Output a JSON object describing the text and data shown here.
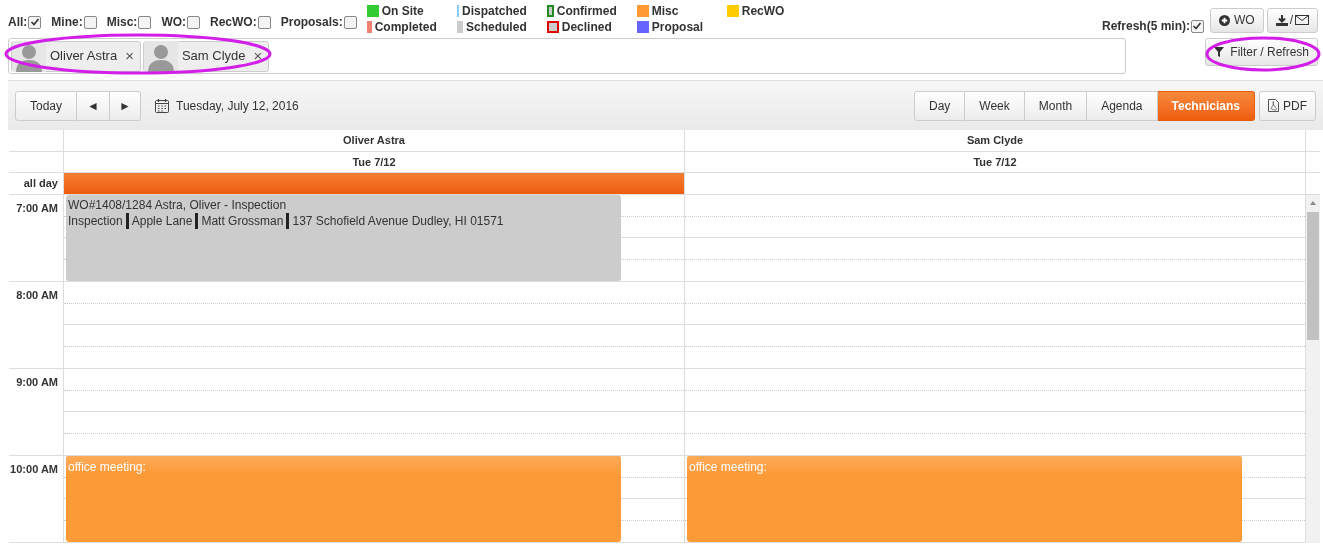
{
  "filters": [
    {
      "label": "All:",
      "checked": true
    },
    {
      "label": "Mine:",
      "checked": false
    },
    {
      "label": "Misc:",
      "checked": false
    },
    {
      "label": "WO:",
      "checked": false
    },
    {
      "label": "RecWO:",
      "checked": false
    },
    {
      "label": "Proposals:",
      "checked": false
    }
  ],
  "legend": [
    {
      "label": "On Site",
      "kind": "fill",
      "color": "#33cc33"
    },
    {
      "label": "Completed",
      "kind": "fill",
      "color": "#f08070"
    },
    {
      "label": "Dispatched",
      "kind": "fill",
      "color": "#87cefa"
    },
    {
      "label": "Scheduled",
      "kind": "fill",
      "color": "#cccccc"
    },
    {
      "label": "Confirmed",
      "kind": "outline",
      "color": "#228b22"
    },
    {
      "label": "Declined",
      "kind": "outline",
      "color": "#e00000"
    },
    {
      "label": "Misc",
      "kind": "fill",
      "color": "#ff9933"
    },
    {
      "label": "Proposal",
      "kind": "fill",
      "color": "#6666ff"
    },
    {
      "label": "RecWO",
      "kind": "fill",
      "color": "#ffcc00"
    }
  ],
  "refresh": {
    "label": "Refresh(5 min):",
    "checked": true
  },
  "wo_button": "WO",
  "export_button": "/",
  "technician_chips": [
    {
      "name": "Oliver Astra",
      "remove": "×"
    },
    {
      "name": "Sam Clyde",
      "remove": "×"
    }
  ],
  "filter_button": "Filter / Refresh",
  "toolbar": {
    "today": "Today",
    "prev": "◄",
    "next": "►",
    "date": "Tuesday, July 12, 2016",
    "views": [
      {
        "label": "Day",
        "selected": false
      },
      {
        "label": "Week",
        "selected": false
      },
      {
        "label": "Month",
        "selected": false
      },
      {
        "label": "Agenda",
        "selected": false
      },
      {
        "label": "Technicians",
        "selected": true
      }
    ],
    "pdf": "PDF"
  },
  "calendar": {
    "all_day_label": "all day",
    "columns": [
      {
        "name": "Oliver Astra",
        "date": "Tue 7/12",
        "all_day_event": true
      },
      {
        "name": "Sam Clyde",
        "date": "Tue 7/12",
        "all_day_event": false
      }
    ],
    "hours": [
      {
        "label": "7:00 AM",
        "cells": [
          {
            "kind": "work_order",
            "title": "WO#1408/1284 Astra, Oliver - Inspection",
            "details": [
              "Inspection",
              "Apple Lane",
              "Matt Grossman",
              "137 Schofield Avenue Dudley, HI 01571"
            ]
          },
          {
            "kind": "empty"
          }
        ]
      },
      {
        "label": "8:00 AM",
        "cells": [
          {
            "kind": "empty"
          },
          {
            "kind": "empty"
          }
        ]
      },
      {
        "label": "9:00 AM",
        "cells": [
          {
            "kind": "empty"
          },
          {
            "kind": "empty"
          }
        ]
      },
      {
        "label": "10:00 AM",
        "cells": [
          {
            "kind": "meeting",
            "title": "office meeting:"
          },
          {
            "kind": "meeting",
            "title": "office meeting:"
          }
        ]
      }
    ]
  }
}
